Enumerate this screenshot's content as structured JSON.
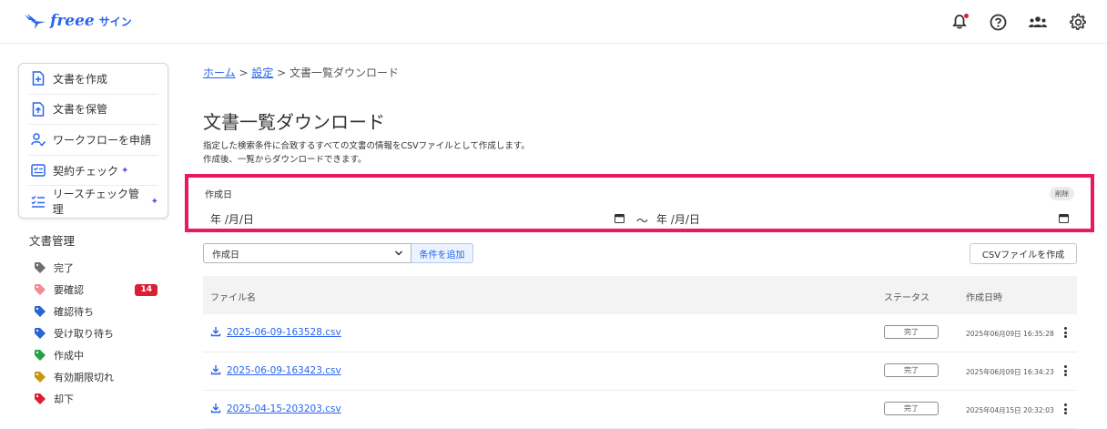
{
  "header": {
    "logo_text": "freee",
    "logo_sub": "サイン",
    "icons": [
      "bell-icon",
      "help-icon",
      "team-icon",
      "gear-icon"
    ],
    "notification_dot": true
  },
  "sidebar": {
    "actions": [
      {
        "label": "文書を作成",
        "icon": "document-plus-icon"
      },
      {
        "label": "文書を保管",
        "icon": "document-upload-icon"
      },
      {
        "label": "ワークフローを申請",
        "icon": "user-check-icon"
      },
      {
        "label": "契約チェック",
        "icon": "checklist-icon",
        "sparkle": true
      },
      {
        "label": "リースチェック管理",
        "icon": "list-check-icon",
        "sparkle": true
      }
    ],
    "section_title": "文書管理",
    "tags": [
      {
        "label": "完了",
        "color": "#6e6e6e"
      },
      {
        "label": "要確認",
        "color": "#f08c96",
        "badge": "14"
      },
      {
        "label": "確認待ち",
        "color": "#2864d2"
      },
      {
        "label": "受け取り待ち",
        "color": "#2864d2"
      },
      {
        "label": "作成中",
        "color": "#28a046"
      },
      {
        "label": "有効期限切れ",
        "color": "#c89614"
      },
      {
        "label": "却下",
        "color": "#dc1e32"
      }
    ]
  },
  "breadcrumb": {
    "home": "ホーム",
    "sep1": " > ",
    "settings": "設定",
    "sep2": " > ",
    "current": "文書一覧ダウンロード"
  },
  "page": {
    "title": "文書一覧ダウンロード",
    "desc_line1": "指定した検索条件に合致するすべての文書の情報をCSVファイルとして作成します。",
    "desc_line2": "作成後、一覧からダウンロードできます。"
  },
  "filter": {
    "label": "作成日",
    "delete_label": "削除",
    "from_placeholder": "年 /月/日",
    "to_placeholder": "年 /月/日",
    "tilde": "〜",
    "highlight_color": "#e9195a"
  },
  "controls": {
    "select_value": "作成日",
    "add_condition": "条件を追加",
    "create_csv": "CSVファイルを作成"
  },
  "table": {
    "headers": {
      "file": "ファイル名",
      "status": "ステータス",
      "created": "作成日時"
    },
    "rows": [
      {
        "file": "2025-06-09-163528.csv",
        "status": "完了",
        "created": "2025年06月09日 16:35:28"
      },
      {
        "file": "2025-06-09-163423.csv",
        "status": "完了",
        "created": "2025年06月09日 16:34:23"
      },
      {
        "file": "2025-04-15-203203.csv",
        "status": "完了",
        "created": "2025年04月15日 20:32:03"
      }
    ]
  }
}
